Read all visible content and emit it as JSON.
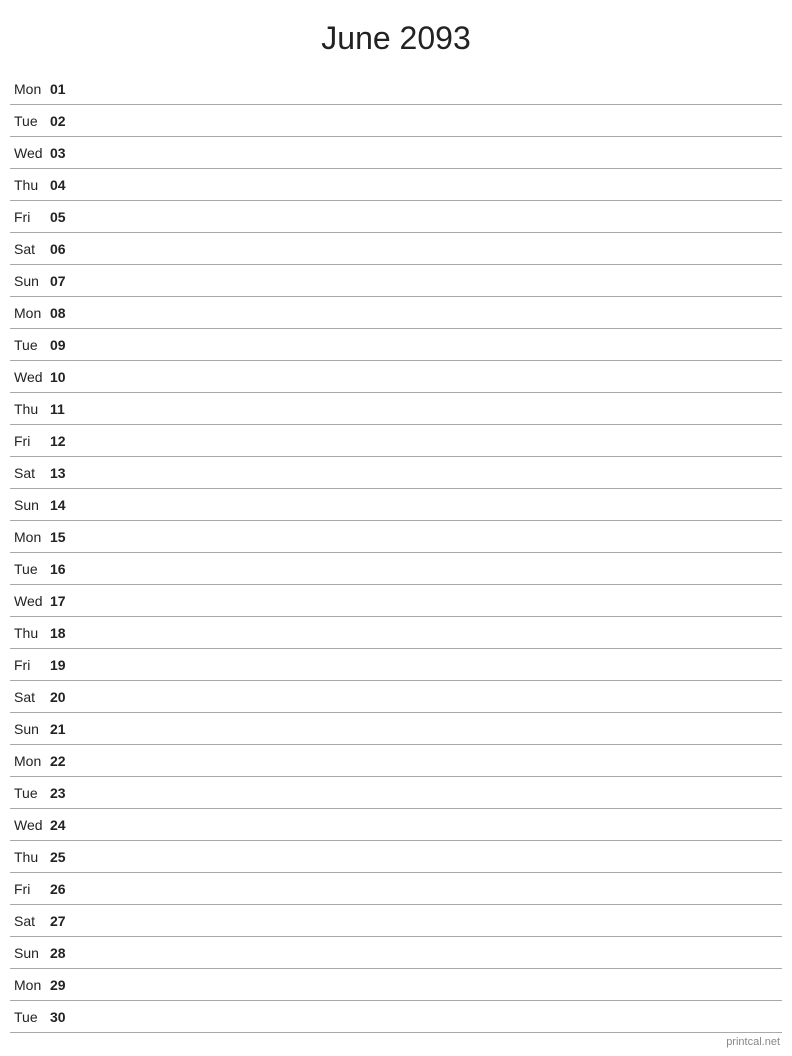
{
  "header": {
    "title": "June 2093"
  },
  "days": [
    {
      "name": "Mon",
      "number": "01"
    },
    {
      "name": "Tue",
      "number": "02"
    },
    {
      "name": "Wed",
      "number": "03"
    },
    {
      "name": "Thu",
      "number": "04"
    },
    {
      "name": "Fri",
      "number": "05"
    },
    {
      "name": "Sat",
      "number": "06"
    },
    {
      "name": "Sun",
      "number": "07"
    },
    {
      "name": "Mon",
      "number": "08"
    },
    {
      "name": "Tue",
      "number": "09"
    },
    {
      "name": "Wed",
      "number": "10"
    },
    {
      "name": "Thu",
      "number": "11"
    },
    {
      "name": "Fri",
      "number": "12"
    },
    {
      "name": "Sat",
      "number": "13"
    },
    {
      "name": "Sun",
      "number": "14"
    },
    {
      "name": "Mon",
      "number": "15"
    },
    {
      "name": "Tue",
      "number": "16"
    },
    {
      "name": "Wed",
      "number": "17"
    },
    {
      "name": "Thu",
      "number": "18"
    },
    {
      "name": "Fri",
      "number": "19"
    },
    {
      "name": "Sat",
      "number": "20"
    },
    {
      "name": "Sun",
      "number": "21"
    },
    {
      "name": "Mon",
      "number": "22"
    },
    {
      "name": "Tue",
      "number": "23"
    },
    {
      "name": "Wed",
      "number": "24"
    },
    {
      "name": "Thu",
      "number": "25"
    },
    {
      "name": "Fri",
      "number": "26"
    },
    {
      "name": "Sat",
      "number": "27"
    },
    {
      "name": "Sun",
      "number": "28"
    },
    {
      "name": "Mon",
      "number": "29"
    },
    {
      "name": "Tue",
      "number": "30"
    }
  ],
  "watermark": "printcal.net"
}
